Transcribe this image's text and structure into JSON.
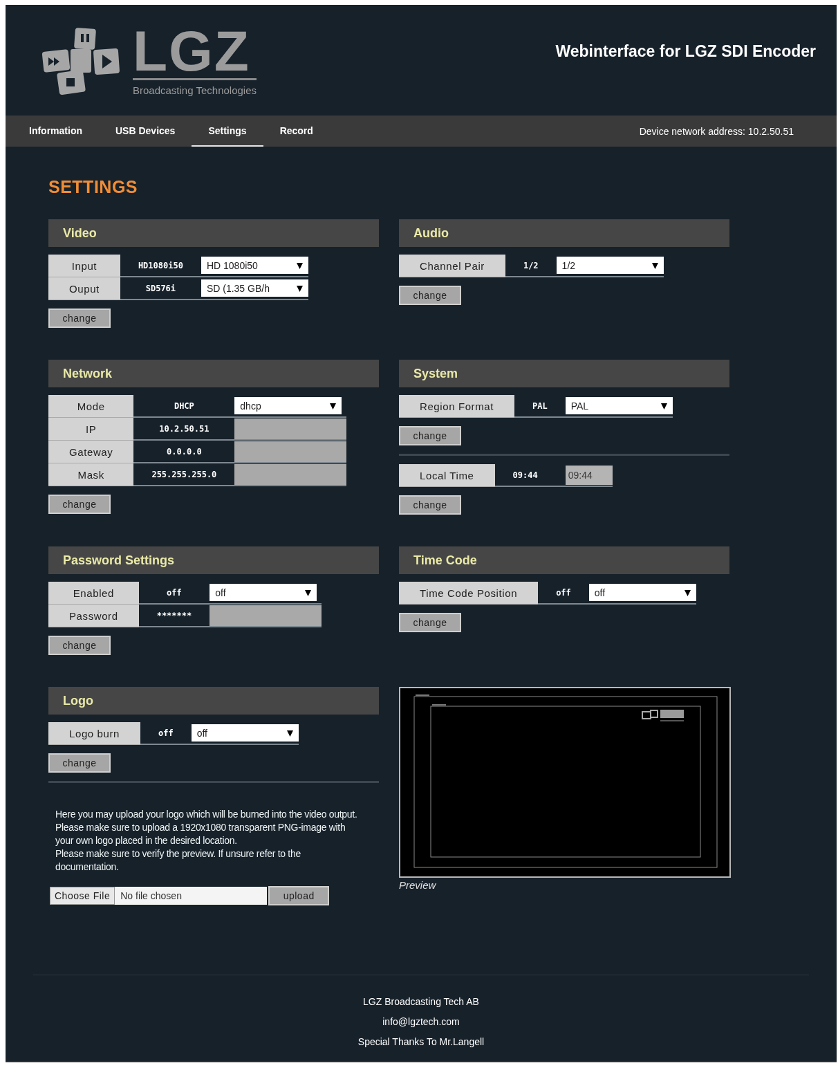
{
  "header": {
    "logo": {
      "name": "LGZ",
      "tagline": "Broadcasting Technologies"
    },
    "title": "Webinterface for LGZ SDI Encoder"
  },
  "tabs": [
    {
      "label": "Information",
      "selected": false
    },
    {
      "label": "USB Devices",
      "selected": false
    },
    {
      "label": "Settings",
      "selected": true
    },
    {
      "label": "Record",
      "selected": false
    }
  ],
  "device_address": "Device network address: 10.2.50.51",
  "page_title": "SETTINGS",
  "sections": [
    {
      "kind": "form",
      "title": "Video",
      "groups": [
        {
          "rows": [
            {
              "label": "Input",
              "value": "HD1080i50",
              "control": {
                "kind": "select",
                "value": "HD 1080i50"
              }
            },
            {
              "label": "Ouput",
              "value": "SD576i",
              "control": {
                "kind": "select",
                "value": "SD (1.35 GB/h"
              }
            }
          ],
          "button": "change"
        }
      ]
    },
    {
      "kind": "form",
      "title": "Audio",
      "groups": [
        {
          "rows": [
            {
              "label": "Channel Pair",
              "value": "1/2",
              "control": {
                "kind": "select",
                "value": "1/2"
              }
            }
          ],
          "button": "change"
        }
      ]
    },
    {
      "kind": "form",
      "title": "Network",
      "groups": [
        {
          "rows": [
            {
              "label": "Mode",
              "value": "DHCP",
              "control": {
                "kind": "select",
                "value": "dhcp"
              }
            },
            {
              "label": "IP",
              "value": "10.2.50.51",
              "control": {
                "kind": "input"
              }
            },
            {
              "label": "Gateway",
              "value": "0.0.0.0",
              "control": {
                "kind": "input"
              }
            },
            {
              "label": "Mask",
              "value": "255.255.255.0",
              "control": {
                "kind": "input"
              }
            }
          ],
          "button": "change"
        }
      ]
    },
    {
      "kind": "form",
      "title": "System",
      "groups": [
        {
          "rows": [
            {
              "label": "Region Format",
              "value": "PAL",
              "control": {
                "kind": "select",
                "value": "PAL"
              }
            }
          ],
          "button": "change"
        },
        {
          "rows": [
            {
              "label": "Local Time",
              "value": "09:44",
              "control": {
                "kind": "input",
                "placeholder": "09:44"
              }
            }
          ],
          "button": "change"
        }
      ]
    },
    {
      "kind": "form",
      "title": "Password Settings",
      "groups": [
        {
          "rows": [
            {
              "label": "Enabled",
              "value": "off",
              "control": {
                "kind": "select",
                "value": "off"
              }
            },
            {
              "label": "Password",
              "value": "*******",
              "control": {
                "kind": "input"
              }
            }
          ],
          "button": "change"
        }
      ]
    },
    {
      "kind": "form",
      "title": "Time Code",
      "groups": [
        {
          "rows": [
            {
              "label": "Time Code Position",
              "value": "off",
              "control": {
                "kind": "select",
                "value": "off"
              }
            }
          ],
          "button": "change"
        }
      ]
    },
    {
      "kind": "form",
      "title": "Logo",
      "groups": [
        {
          "rows": [
            {
              "label": "Logo burn",
              "value": "off",
              "control": {
                "kind": "select",
                "value": "off"
              }
            }
          ],
          "button": "change"
        }
      ],
      "note": [
        "Here you may upload your logo which will be burned into the video output. Please make sure to upload a 1920x1080 transparent PNG-image with your own logo placed in the desired location.",
        "Please make sure to verify the preview. If unsure refer to the documentation."
      ],
      "upload": {
        "choose": "Choose File",
        "file": "No file chosen",
        "button": "upload"
      }
    },
    {
      "kind": "preview",
      "caption": "Preview"
    }
  ],
  "footer": [
    "LGZ Broadcasting Tech AB",
    "info@lgztech.com",
    "Special Thanks To Mr.Langell"
  ]
}
